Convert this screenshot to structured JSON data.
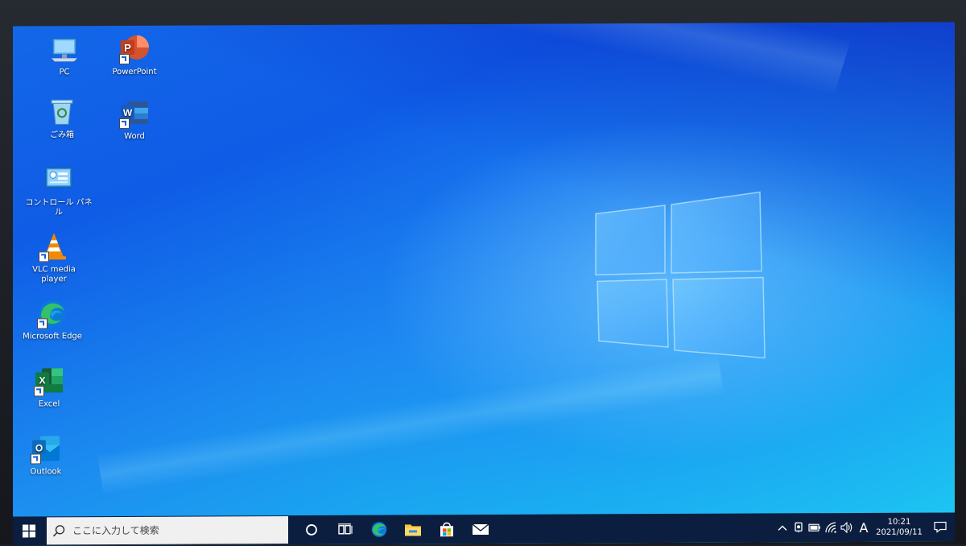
{
  "desktop": {
    "icons": [
      {
        "label": "PC",
        "icon": "pc-icon"
      },
      {
        "label": "PowerPoint",
        "icon": "powerpoint-icon"
      },
      {
        "label": "ごみ箱",
        "icon": "recycle-bin-icon"
      },
      {
        "label": "Word",
        "icon": "word-icon"
      },
      {
        "label": "コントロール パネル",
        "icon": "control-panel-icon"
      },
      {
        "label": "VLC media player",
        "icon": "vlc-icon"
      },
      {
        "label": "Microsoft Edge",
        "icon": "edge-icon"
      },
      {
        "label": "Excel",
        "icon": "excel-icon"
      },
      {
        "label": "Outlook",
        "icon": "outlook-icon"
      }
    ],
    "icon_letters": {
      "powerpoint": "P",
      "word": "W",
      "excel": "X",
      "outlook": "O"
    }
  },
  "taskbar": {
    "search_placeholder": "ここに入力して検索",
    "pinned": [
      "cortana-icon",
      "task-view-icon",
      "edge-icon",
      "file-explorer-icon",
      "store-icon",
      "mail-icon"
    ],
    "tray": {
      "ime_indicator": "A",
      "time": "10:21",
      "date": "2021/09/11"
    }
  },
  "colors": {
    "taskbar": "#0c1e3f",
    "desktop_blue": "#1467e8",
    "powerpoint": "#c43e1c",
    "word": "#2b579a",
    "excel": "#217346",
    "outlook": "#0f6cbd",
    "vlc": "#f18a00"
  }
}
